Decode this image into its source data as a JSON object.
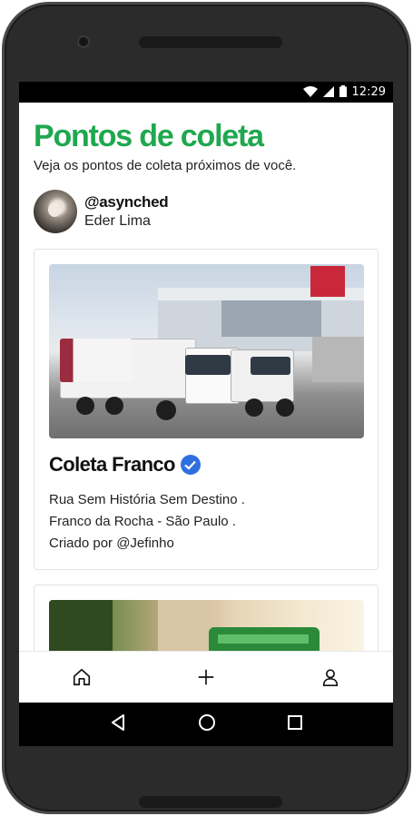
{
  "status_bar": {
    "time": "12:29"
  },
  "header": {
    "title": "Pontos de coleta",
    "subtitle": "Veja os pontos de coleta próximos de você."
  },
  "profile": {
    "handle": "@asynched",
    "name": "Eder Lima"
  },
  "cards": [
    {
      "title": "Coleta Franco",
      "verified": true,
      "lines": [
        "Rua Sem História Sem Destino .",
        "Franco da Rocha - São Paulo .",
        "Criado por @Jefinho"
      ]
    }
  ],
  "nav": {
    "items": [
      "home-icon",
      "plus-icon",
      "user-icon"
    ]
  },
  "colors": {
    "accent": "#1fa84f",
    "verified": "#2f6fe0"
  }
}
